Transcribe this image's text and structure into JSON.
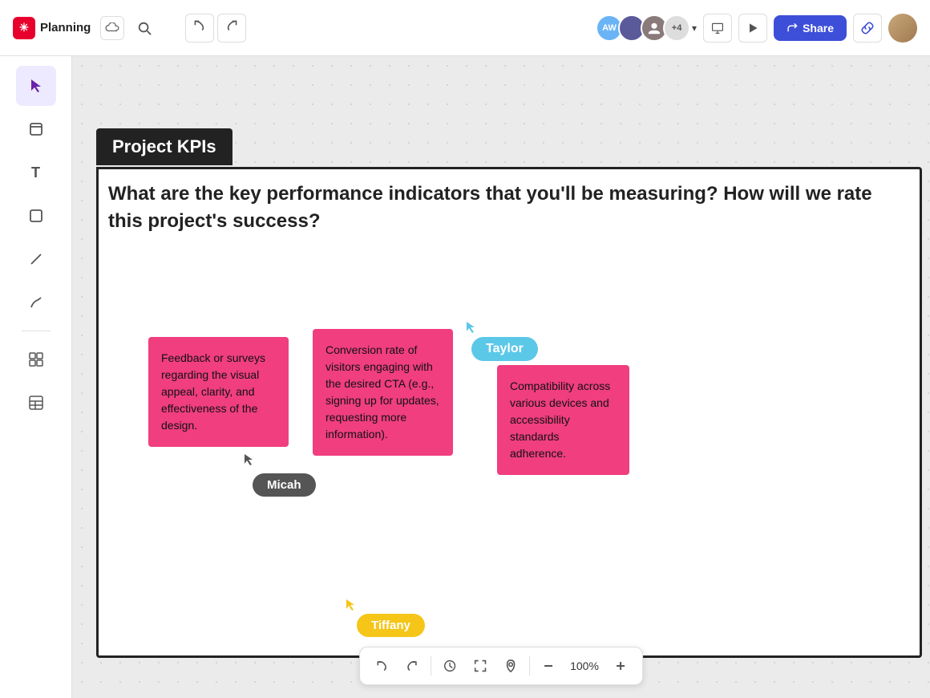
{
  "app": {
    "name": "Planning",
    "logo_letter": "✳"
  },
  "toolbar": {
    "undo_label": "←",
    "redo_label": "→",
    "share_label": "Share",
    "zoom_level": "100%"
  },
  "collaborators": [
    {
      "id": "avatar-1",
      "initials": "AW"
    },
    {
      "id": "avatar-2",
      "initials": ""
    },
    {
      "id": "avatar-3",
      "initials": ""
    },
    {
      "id": "avatar-more",
      "label": "+4"
    }
  ],
  "tools": [
    {
      "id": "select",
      "icon": "↖",
      "active": true
    },
    {
      "id": "frame",
      "icon": "▢",
      "active": false
    },
    {
      "id": "text",
      "icon": "T",
      "active": false
    },
    {
      "id": "shape",
      "icon": "□",
      "active": false
    },
    {
      "id": "line",
      "icon": "╱",
      "active": false
    },
    {
      "id": "pen",
      "icon": "〜",
      "active": false
    },
    {
      "id": "grid",
      "icon": "⊞",
      "active": false
    },
    {
      "id": "table",
      "icon": "⊟",
      "active": false
    }
  ],
  "canvas": {
    "frame_title": "Project KPIs",
    "question_text": "What are the key performance indicators that you'll be measuring? How will we rate this project's success?",
    "sticky_notes": [
      {
        "id": "sticky-1",
        "text": "Feedback or surveys regarding the visual appeal, clarity, and effectiveness of the design.",
        "color": "#f03e7e"
      },
      {
        "id": "sticky-2",
        "text": "Conversion rate of visitors engaging with the desired CTA (e.g., signing up for updates, requesting more information).",
        "color": "#f03e7e"
      },
      {
        "id": "sticky-3",
        "text": "Compatibility across various devices and accessibility standards adherence.",
        "color": "#f03e7e"
      }
    ],
    "cursors": [
      {
        "id": "micah",
        "name": "Micah",
        "color": "#555555"
      },
      {
        "id": "taylor",
        "name": "Taylor",
        "color": "#5bc8e8"
      },
      {
        "id": "tiffany",
        "name": "Tiffany",
        "color": "#f5c518"
      }
    ]
  },
  "bottom_toolbar": {
    "zoom": "100%"
  }
}
